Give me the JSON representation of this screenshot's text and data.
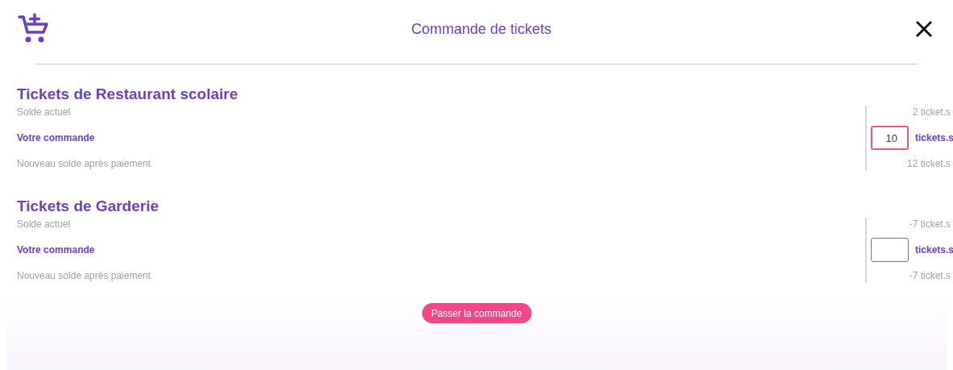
{
  "header": {
    "title": "Commande de tickets"
  },
  "sections": [
    {
      "title": "Tickets de Restaurant scolaire",
      "balance_label": "Solde actuel",
      "balance": "2 ticket.s",
      "order_label": "Votre commande",
      "order_value": "10",
      "order_focused": true,
      "order_unit": "tickets.s",
      "new_balance_label": "Nouveau solde après paiement",
      "new_balance": "12 ticket.s"
    },
    {
      "title": "Tickets de Garderie",
      "balance_label": "Solde actuel",
      "balance": "-7 ticket.s",
      "order_label": "Votre commande",
      "order_focused": false,
      "order_unit": "tickets.s",
      "new_balance_label": "Nouveau solde après paiement",
      "new_balance": "-7 ticket.s"
    }
  ],
  "submit_button": "Passer la commande"
}
